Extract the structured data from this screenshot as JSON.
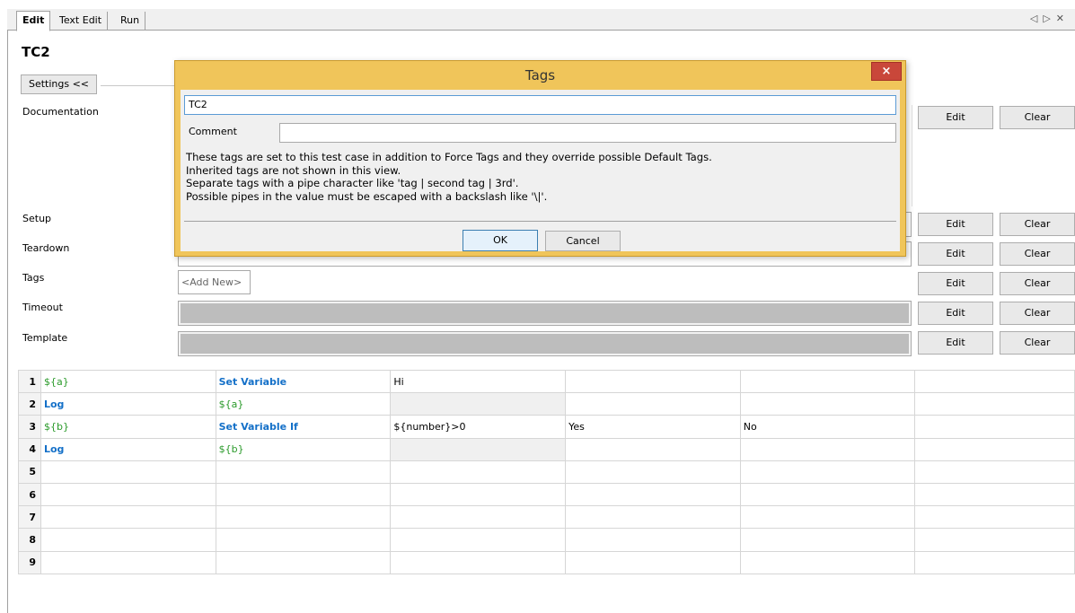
{
  "tabs": [
    {
      "label": "Edit"
    },
    {
      "label": "Text Edit"
    },
    {
      "label": "Run"
    }
  ],
  "tab_nav": {
    "prev": "◁",
    "next": "▷",
    "close": "✕"
  },
  "page_title": "TC2",
  "settings_label": "Settings <<",
  "fields": {
    "documentation": {
      "label": "Documentation",
      "edit": "Edit",
      "clear": "Clear"
    },
    "setup": {
      "label": "Setup",
      "edit": "Edit",
      "clear": "Clear"
    },
    "teardown": {
      "label": "Teardown",
      "edit": "Edit",
      "clear": "Clear"
    },
    "tags": {
      "label": "Tags",
      "add_new": "<Add New>",
      "edit": "Edit",
      "clear": "Clear"
    },
    "timeout": {
      "label": "Timeout",
      "edit": "Edit",
      "clear": "Clear"
    },
    "template": {
      "label": "Template",
      "edit": "Edit",
      "clear": "Clear"
    }
  },
  "grid": {
    "rows": [
      {
        "num": "1",
        "cells": [
          "${a}",
          "Set Variable",
          "Hi",
          "",
          "",
          ""
        ]
      },
      {
        "num": "2",
        "cells": [
          "Log",
          "${a}",
          "",
          "",
          "",
          ""
        ]
      },
      {
        "num": "3",
        "cells": [
          "${b}",
          "Set Variable If",
          "${number}>0",
          "Yes",
          "No",
          ""
        ]
      },
      {
        "num": "4",
        "cells": [
          "Log",
          "${b}",
          "",
          "",
          "",
          ""
        ]
      },
      {
        "num": "5",
        "cells": [
          "",
          "",
          "",
          "",
          "",
          ""
        ]
      },
      {
        "num": "6",
        "cells": [
          "",
          "",
          "",
          "",
          "",
          ""
        ]
      },
      {
        "num": "7",
        "cells": [
          "",
          "",
          "",
          "",
          "",
          ""
        ]
      },
      {
        "num": "8",
        "cells": [
          "",
          "",
          "",
          "",
          "",
          ""
        ]
      },
      {
        "num": "9",
        "cells": [
          "",
          "",
          "",
          "",
          "",
          ""
        ]
      }
    ]
  },
  "dialog": {
    "title": "Tags",
    "close": "×",
    "value": "TC2",
    "comment_label": "Comment",
    "comment_value": "",
    "help": [
      "These tags are set to this test case in addition to Force Tags and they override possible Default Tags.",
      "Inherited tags are not shown in this view.",
      "Separate tags with a pipe character like 'tag | second tag | 3rd'.",
      "Possible pipes in the value must be escaped with a backslash like '\\|'."
    ],
    "ok": "OK",
    "cancel": "Cancel"
  },
  "colors": {
    "dialog_frame": "#f0c55a",
    "close_button": "#c9473a",
    "variable_text": "#2a9a2a",
    "keyword_text": "#1470c8"
  }
}
